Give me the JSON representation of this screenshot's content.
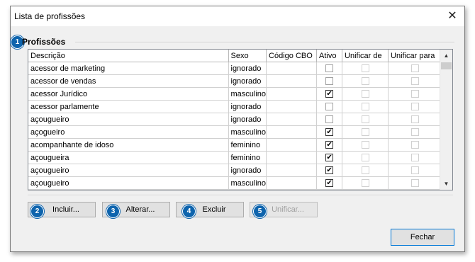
{
  "window": {
    "title": "Lista de profissões",
    "close_label": "✕"
  },
  "group": {
    "label": "Profissões",
    "callout": "1"
  },
  "table": {
    "columns": [
      "Descrição",
      "Sexo",
      "Código CBO",
      "Ativo",
      "Unificar de",
      "Unificar para"
    ],
    "rows": [
      {
        "descricao": "acessor de marketing",
        "sexo": "ignorado",
        "cbo": "",
        "ativo": false
      },
      {
        "descricao": "acessor de vendas",
        "sexo": "ignorado",
        "cbo": "",
        "ativo": false
      },
      {
        "descricao": "acessor Jurídico",
        "sexo": "masculino",
        "cbo": "",
        "ativo": true
      },
      {
        "descricao": "acessor parlamente",
        "sexo": "ignorado",
        "cbo": "",
        "ativo": false
      },
      {
        "descricao": "açougueiro",
        "sexo": "ignorado",
        "cbo": "",
        "ativo": false
      },
      {
        "descricao": "açogueiro",
        "sexo": "masculino",
        "cbo": "",
        "ativo": true
      },
      {
        "descricao": "acompanhante de idoso",
        "sexo": "feminino",
        "cbo": "",
        "ativo": true
      },
      {
        "descricao": "açougueira",
        "sexo": "feminino",
        "cbo": "",
        "ativo": true
      },
      {
        "descricao": "açougueiro",
        "sexo": "ignorado",
        "cbo": "",
        "ativo": true
      },
      {
        "descricao": "açougueiro",
        "sexo": "masculino",
        "cbo": "",
        "ativo": true
      }
    ],
    "scroll_up_icon": "▲",
    "scroll_down_icon": "▼"
  },
  "buttons": {
    "incluir": {
      "label": "Incluir...",
      "callout": "2"
    },
    "alterar": {
      "label": "Alterar...",
      "callout": "3"
    },
    "excluir": {
      "label": "Excluir",
      "callout": "4"
    },
    "unificar": {
      "label": "Unificar...",
      "callout": "5"
    },
    "fechar": {
      "label": "Fechar"
    }
  },
  "colors": {
    "callout": "#0e64ad",
    "focus_border": "#0078d7"
  }
}
